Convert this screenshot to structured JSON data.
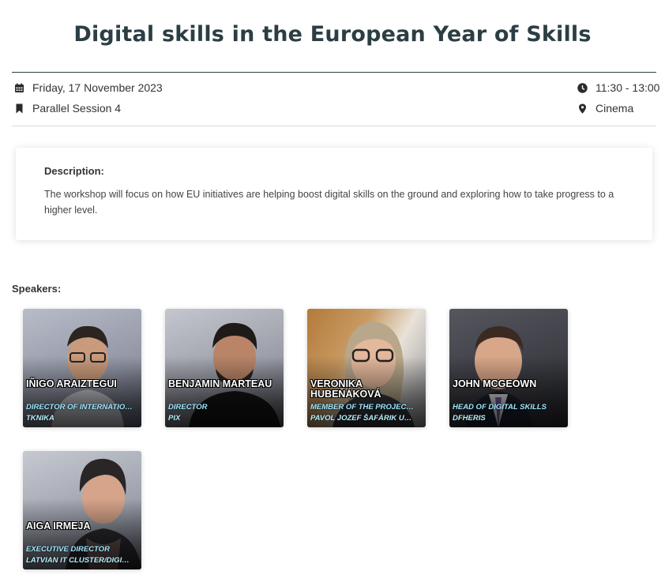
{
  "event": {
    "title": "Digital skills in the European Year of Skills",
    "date": "Friday, 17 November 2023",
    "session": "Parallel Session 4",
    "time": "11:30 - 13:00",
    "location": "Cinema"
  },
  "icons": {
    "date": "calendar-icon",
    "session": "bookmark-icon",
    "time": "clock-icon",
    "location": "map-pin-icon"
  },
  "description": {
    "label": "Description:",
    "text": "The workshop will focus on how EU initiatives are helping boost digital skills on the ground and exploring how to take progress to a higher level."
  },
  "speakers": {
    "label": "Speakers:",
    "items": [
      {
        "name": "IÑIGO ARAIZTEGUI",
        "role": "DIRECTOR OF INTERNATIO…",
        "org": "TKNIKA"
      },
      {
        "name": "BENJAMIN MARTEAU",
        "role": "DIRECTOR",
        "org": "PIX"
      },
      {
        "name": "VERONIKA HUBEŇÁKOVÁ",
        "role": "MEMBER OF THE PROJEC…",
        "org": "PAVOL JOZEF ŠAFÁRIK U…"
      },
      {
        "name": "JOHN MCGEOWN",
        "role": "HEAD OF DIGITAL SKILLS",
        "org": "DFHERIS"
      },
      {
        "name": "AIGA IRMEJA",
        "role": "EXECUTIVE DIRECTOR",
        "org": "LATVIAN IT CLUSTER/DIGI…"
      }
    ]
  },
  "colors": {
    "title": "#2c3e44",
    "role_text": "#9fe7ff"
  }
}
